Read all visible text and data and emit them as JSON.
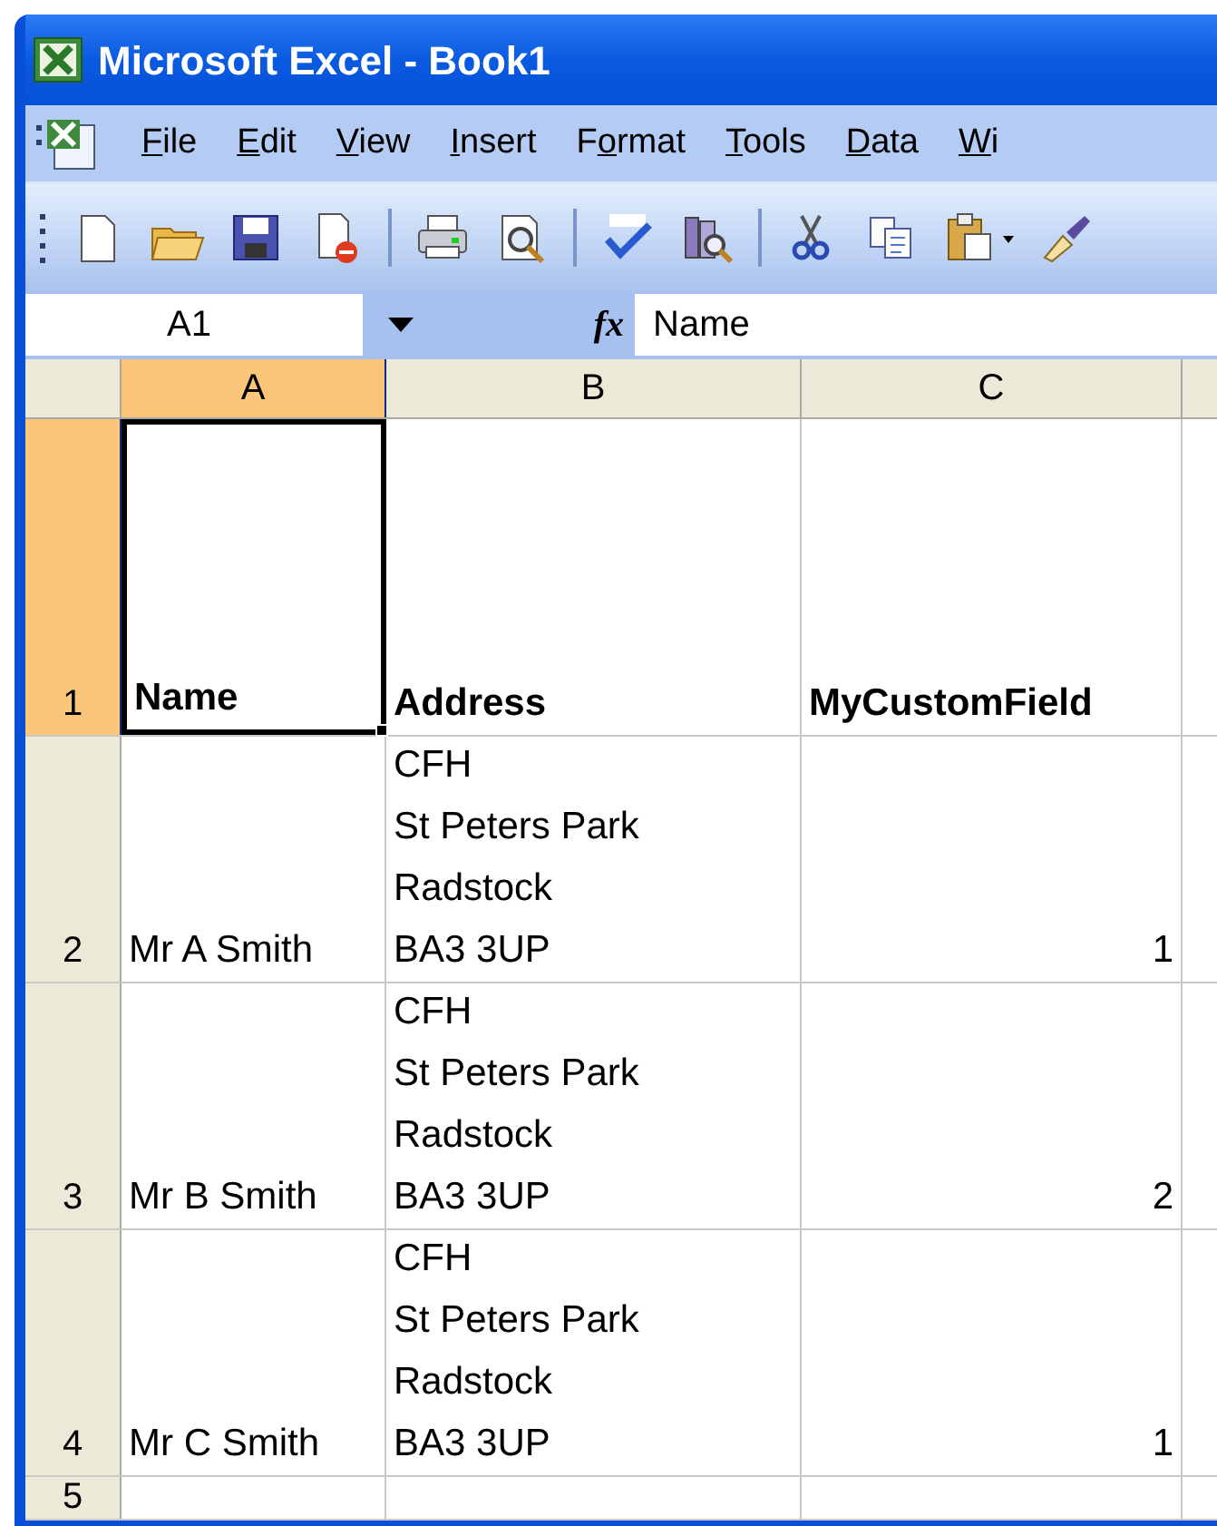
{
  "window": {
    "title": "Microsoft Excel - Book1"
  },
  "menu": [
    {
      "key": "F",
      "after": "ile"
    },
    {
      "key": "E",
      "after": "dit"
    },
    {
      "key": "V",
      "after": "iew"
    },
    {
      "key": "I",
      "after": "nsert"
    },
    {
      "before": "F",
      "key": "o",
      "after": "rmat"
    },
    {
      "key": "T",
      "after": "ools"
    },
    {
      "key": "D",
      "after": "ata"
    },
    {
      "key": "W",
      "after": "i"
    }
  ],
  "toolbar": [
    {
      "kind": "new"
    },
    {
      "kind": "open"
    },
    {
      "kind": "save"
    },
    {
      "kind": "permission"
    },
    {
      "kind": "separator"
    },
    {
      "kind": "print"
    },
    {
      "kind": "preview"
    },
    {
      "kind": "separator"
    },
    {
      "kind": "spelling"
    },
    {
      "kind": "research"
    },
    {
      "kind": "separator"
    },
    {
      "kind": "cut"
    },
    {
      "kind": "copy"
    },
    {
      "kind": "paste"
    },
    {
      "kind": "painter"
    }
  ],
  "formula_bar": {
    "name_box": "A1",
    "function_label": "fx",
    "formula": "Name"
  },
  "columns": [
    {
      "label": "A",
      "selected": true
    },
    {
      "label": "B",
      "selected": false
    },
    {
      "label": "C",
      "selected": false
    }
  ],
  "rows": [
    {
      "number": "1",
      "selected": true,
      "bold": true,
      "cells": [
        {
          "value": "Name",
          "kind": "text",
          "selected": true
        },
        {
          "value": "Address",
          "kind": "text",
          "selected": false
        },
        {
          "value": "MyCustomField",
          "kind": "text",
          "selected": false
        }
      ]
    },
    {
      "number": "2",
      "selected": false,
      "bold": false,
      "cells": [
        {
          "value": "Mr A Smith",
          "kind": "text",
          "selected": false
        },
        {
          "value": "CFH\nSt Peters Park\nRadstock\nBA3 3UP",
          "kind": "text",
          "selected": false
        },
        {
          "value": "1",
          "kind": "number",
          "selected": false
        }
      ]
    },
    {
      "number": "3",
      "selected": false,
      "bold": false,
      "cells": [
        {
          "value": "Mr B Smith",
          "kind": "text",
          "selected": false
        },
        {
          "value": "CFH\nSt Peters Park\nRadstock\nBA3 3UP",
          "kind": "text",
          "selected": false
        },
        {
          "value": "2",
          "kind": "number",
          "selected": false
        }
      ]
    },
    {
      "number": "4",
      "selected": false,
      "bold": false,
      "cells": [
        {
          "value": "Mr C Smith",
          "kind": "text",
          "selected": false
        },
        {
          "value": "CFH\nSt Peters Park\nRadstock\nBA3 3UP",
          "kind": "text",
          "selected": false
        },
        {
          "value": "1",
          "kind": "number",
          "selected": false
        }
      ]
    },
    {
      "number": "5",
      "selected": false,
      "cells": []
    }
  ]
}
